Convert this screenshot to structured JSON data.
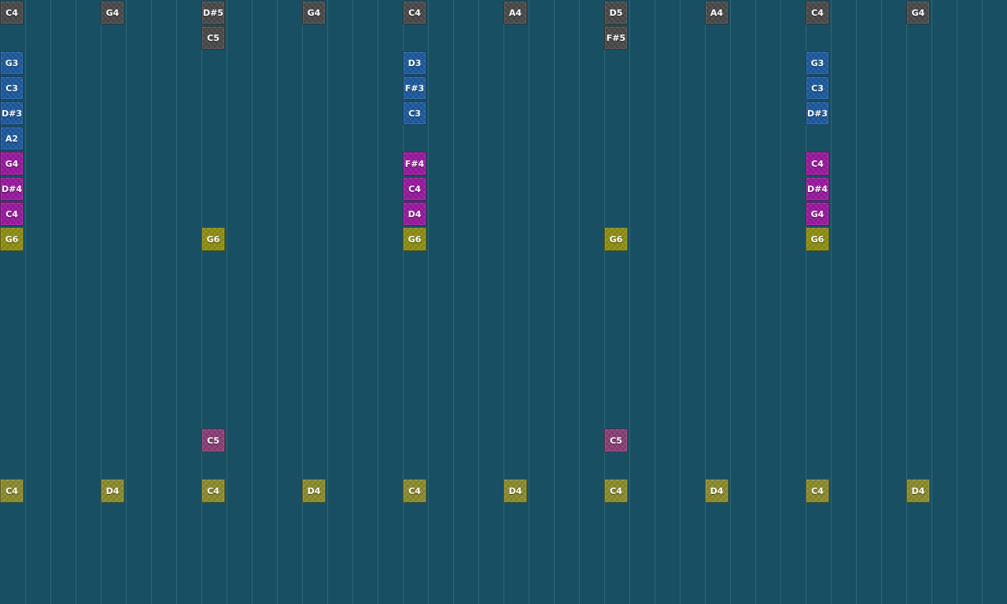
{
  "colors": {
    "background": "#194f62",
    "grid_line": "#2c6878",
    "gray": "#4a4a4a",
    "blue": "#1d5b9e",
    "magenta": "#9a1a9f",
    "yellow": "#8f8f14",
    "pink": "#8a3f76",
    "olive": "#8c8c2e"
  },
  "grid": {
    "columns": 40
  },
  "notes": [
    {
      "label": "C4",
      "color": "gray",
      "col": 0,
      "row": 0
    },
    {
      "label": "G4",
      "color": "gray",
      "col": 4,
      "row": 0
    },
    {
      "label": "D#5",
      "color": "gray",
      "col": 8,
      "row": 0
    },
    {
      "label": "C5",
      "color": "gray",
      "col": 8,
      "row": 1
    },
    {
      "label": "G4",
      "color": "gray",
      "col": 12,
      "row": 0
    },
    {
      "label": "C4",
      "color": "gray",
      "col": 16,
      "row": 0
    },
    {
      "label": "A4",
      "color": "gray",
      "col": 20,
      "row": 0
    },
    {
      "label": "D5",
      "color": "gray",
      "col": 24,
      "row": 0
    },
    {
      "label": "F#5",
      "color": "gray",
      "col": 24,
      "row": 1
    },
    {
      "label": "A4",
      "color": "gray",
      "col": 28,
      "row": 0
    },
    {
      "label": "C4",
      "color": "gray",
      "col": 32,
      "row": 0
    },
    {
      "label": "G4",
      "color": "gray",
      "col": 36,
      "row": 0
    },
    {
      "label": "G3",
      "color": "blue",
      "col": 0,
      "row": 2
    },
    {
      "label": "C3",
      "color": "blue",
      "col": 0,
      "row": 3
    },
    {
      "label": "D#3",
      "color": "blue",
      "col": 0,
      "row": 4
    },
    {
      "label": "A2",
      "color": "blue",
      "col": 0,
      "row": 5
    },
    {
      "label": "D3",
      "color": "blue",
      "col": 16,
      "row": 2
    },
    {
      "label": "F#3",
      "color": "blue",
      "col": 16,
      "row": 3
    },
    {
      "label": "C3",
      "color": "blue",
      "col": 16,
      "row": 4
    },
    {
      "label": "G3",
      "color": "blue",
      "col": 32,
      "row": 2
    },
    {
      "label": "C3",
      "color": "blue",
      "col": 32,
      "row": 3
    },
    {
      "label": "D#3",
      "color": "blue",
      "col": 32,
      "row": 4
    },
    {
      "label": "G4",
      "color": "magenta",
      "col": 0,
      "row": 6
    },
    {
      "label": "D#4",
      "color": "magenta",
      "col": 0,
      "row": 7
    },
    {
      "label": "C4",
      "color": "magenta",
      "col": 0,
      "row": 8
    },
    {
      "label": "F#4",
      "color": "magenta",
      "col": 16,
      "row": 6
    },
    {
      "label": "C4",
      "color": "magenta",
      "col": 16,
      "row": 7
    },
    {
      "label": "D4",
      "color": "magenta",
      "col": 16,
      "row": 8
    },
    {
      "label": "C4",
      "color": "magenta",
      "col": 32,
      "row": 6
    },
    {
      "label": "D#4",
      "color": "magenta",
      "col": 32,
      "row": 7
    },
    {
      "label": "G4",
      "color": "magenta",
      "col": 32,
      "row": 8
    },
    {
      "label": "G6",
      "color": "yellow",
      "col": 0,
      "row": 9
    },
    {
      "label": "G6",
      "color": "yellow",
      "col": 8,
      "row": 9
    },
    {
      "label": "G6",
      "color": "yellow",
      "col": 16,
      "row": 9
    },
    {
      "label": "G6",
      "color": "yellow",
      "col": 24,
      "row": 9
    },
    {
      "label": "G6",
      "color": "yellow",
      "col": 32,
      "row": 9
    },
    {
      "label": "C5",
      "color": "pink",
      "col": 8,
      "row": 17
    },
    {
      "label": "C5",
      "color": "pink",
      "col": 24,
      "row": 17
    },
    {
      "label": "C4",
      "color": "olive",
      "col": 0,
      "row": 19
    },
    {
      "label": "D4",
      "color": "olive",
      "col": 4,
      "row": 19
    },
    {
      "label": "C4",
      "color": "olive",
      "col": 8,
      "row": 19
    },
    {
      "label": "D4",
      "color": "olive",
      "col": 12,
      "row": 19
    },
    {
      "label": "C4",
      "color": "olive",
      "col": 16,
      "row": 19
    },
    {
      "label": "D4",
      "color": "olive",
      "col": 20,
      "row": 19
    },
    {
      "label": "C4",
      "color": "olive",
      "col": 24,
      "row": 19
    },
    {
      "label": "D4",
      "color": "olive",
      "col": 28,
      "row": 19
    },
    {
      "label": "C4",
      "color": "olive",
      "col": 32,
      "row": 19
    },
    {
      "label": "D4",
      "color": "olive",
      "col": 36,
      "row": 19
    }
  ]
}
